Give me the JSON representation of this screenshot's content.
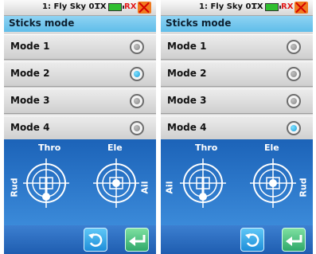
{
  "screens": [
    {
      "status": {
        "model_name": "1: Fly Sky 01",
        "tx_label": "TX",
        "rx_label": "RX"
      },
      "title": "Sticks mode",
      "modes": [
        {
          "label": "Mode 1",
          "selected": false
        },
        {
          "label": "Mode 2",
          "selected": true
        },
        {
          "label": "Mode 3",
          "selected": false
        },
        {
          "label": "Mode 4",
          "selected": false
        }
      ],
      "sticks": {
        "left_top": "Thro",
        "left_side": "Rud",
        "right_top": "Ele",
        "right_side": "Ail"
      }
    },
    {
      "status": {
        "model_name": "1: Fly Sky 01",
        "tx_label": "TX",
        "rx_label": "RX"
      },
      "title": "Sticks mode",
      "modes": [
        {
          "label": "Mode 1",
          "selected": false
        },
        {
          "label": "Mode 2",
          "selected": false
        },
        {
          "label": "Mode 3",
          "selected": false
        },
        {
          "label": "Mode 4",
          "selected": true
        }
      ],
      "sticks": {
        "left_top": "Thro",
        "left_side": "Ail",
        "right_top": "Ele",
        "right_side": "Rud"
      }
    }
  ],
  "icons": {
    "battery": "battery-icon",
    "rx_status": "rx-signal-icon",
    "refresh": "refresh-icon",
    "back": "back-arrow-icon"
  },
  "colors": {
    "title_bar": "#5fbde9",
    "selected_radio": "#1e9fd8",
    "stick_area": "#1c63b8",
    "rx_text": "#e21b1b"
  }
}
